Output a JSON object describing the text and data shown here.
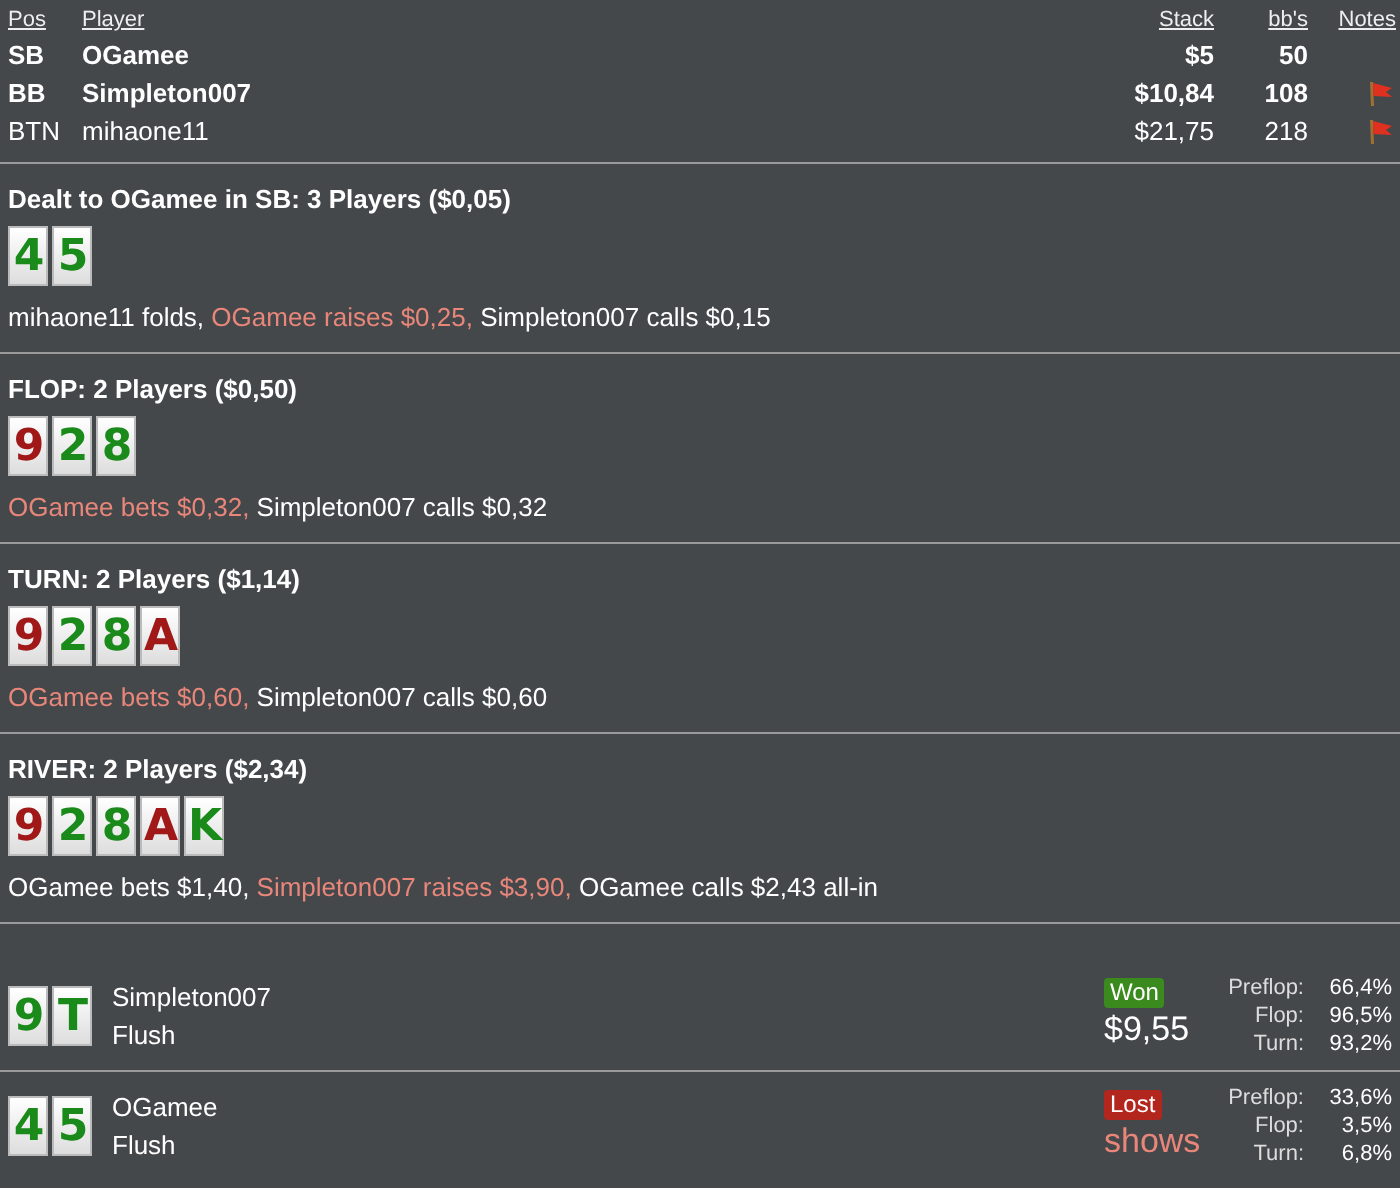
{
  "players_table": {
    "columns": [
      "Pos",
      "Player",
      "Stack",
      "bb's",
      "Notes"
    ],
    "rows": [
      {
        "pos": "SB",
        "player": "OGamee",
        "stack": "$5",
        "bbs": "50",
        "bold": true,
        "flag": false
      },
      {
        "pos": "BB",
        "player": "Simpleton007",
        "stack": "$10,84",
        "bbs": "108",
        "bold": true,
        "flag": true
      },
      {
        "pos": "BTN",
        "player": "mihaone11",
        "stack": "$21,75",
        "bbs": "218",
        "bold": false,
        "flag": true
      }
    ]
  },
  "streets": [
    {
      "title": "Dealt to OGamee in SB: 3 Players ($0,05)",
      "cards": [
        {
          "rank": "4",
          "color": "#1a8a1a"
        },
        {
          "rank": "5",
          "color": "#1a8a1a"
        }
      ],
      "actions": [
        {
          "text": "mihaone11 folds, ",
          "highlight": false
        },
        {
          "text": "OGamee raises $0,25, ",
          "highlight": true
        },
        {
          "text": "Simpleton007 calls $0,15",
          "highlight": false
        }
      ]
    },
    {
      "title": "FLOP: 2 Players ($0,50)",
      "cards": [
        {
          "rank": "9",
          "color": "#a01818"
        },
        {
          "rank": "2",
          "color": "#1a8a1a"
        },
        {
          "rank": "8",
          "color": "#1a8a1a"
        }
      ],
      "actions": [
        {
          "text": "OGamee bets $0,32, ",
          "highlight": true
        },
        {
          "text": "Simpleton007 calls $0,32",
          "highlight": false
        }
      ]
    },
    {
      "title": "TURN: 2 Players ($1,14)",
      "cards": [
        {
          "rank": "9",
          "color": "#a01818"
        },
        {
          "rank": "2",
          "color": "#1a8a1a"
        },
        {
          "rank": "8",
          "color": "#1a8a1a"
        },
        {
          "rank": "A",
          "color": "#a01818"
        }
      ],
      "actions": [
        {
          "text": "OGamee bets $0,60, ",
          "highlight": true
        },
        {
          "text": "Simpleton007 calls $0,60",
          "highlight": false
        }
      ]
    },
    {
      "title": "RIVER: 2 Players ($2,34)",
      "cards": [
        {
          "rank": "9",
          "color": "#a01818"
        },
        {
          "rank": "2",
          "color": "#1a8a1a"
        },
        {
          "rank": "8",
          "color": "#1a8a1a"
        },
        {
          "rank": "A",
          "color": "#a01818"
        },
        {
          "rank": "K",
          "color": "#1a8a1a"
        }
      ],
      "actions": [
        {
          "text": "OGamee bets $1,40, ",
          "highlight": false
        },
        {
          "text": "Simpleton007 raises $3,90, ",
          "highlight": true
        },
        {
          "text": "OGamee calls $2,43 all-in",
          "highlight": false
        }
      ]
    }
  ],
  "showdown": [
    {
      "cards": [
        {
          "rank": "9",
          "color": "#1a8a1a"
        },
        {
          "rank": "T",
          "color": "#1a8a1a"
        }
      ],
      "player": "Simpleton007",
      "hand": "Flush",
      "won": true,
      "badge": "Won",
      "amount": "$9,55",
      "equity": [
        {
          "label": "Preflop:",
          "value": "66,4%"
        },
        {
          "label": "Flop:",
          "value": "96,5%"
        },
        {
          "label": "Turn:",
          "value": "93,2%"
        }
      ]
    },
    {
      "cards": [
        {
          "rank": "4",
          "color": "#1a8a1a"
        },
        {
          "rank": "5",
          "color": "#1a8a1a"
        }
      ],
      "player": "OGamee",
      "hand": "Flush",
      "won": false,
      "badge": "Lost",
      "amount": "shows",
      "equity": [
        {
          "label": "Preflop:",
          "value": "33,6%"
        },
        {
          "label": "Flop:",
          "value": "3,5%"
        },
        {
          "label": "Turn:",
          "value": "6,8%"
        }
      ]
    }
  ]
}
